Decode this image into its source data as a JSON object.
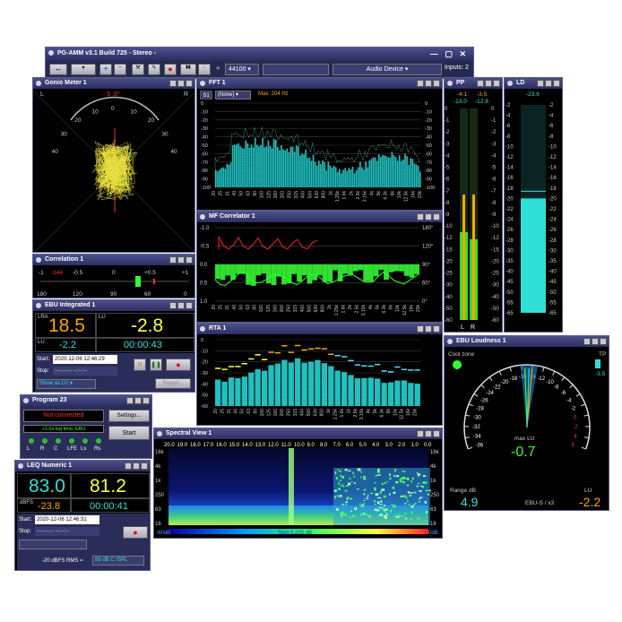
{
  "app": {
    "title": "PG-AMM v3.1 Build 725 - Stereo -",
    "samplerate": "44100",
    "audio_device": "Audio Device",
    "inputs": "Inputs: 2"
  },
  "gonio": {
    "title": "Gonio Meter 1",
    "left": "L",
    "right": "R",
    "angle": "- 5 .9°",
    "scale": [
      "40",
      "30",
      "20",
      "10",
      "0",
      "10",
      "20",
      "30",
      "40"
    ]
  },
  "fft": {
    "title": "FFT 1",
    "slot": "S1",
    "mode": "(None)",
    "max": "Max: 204 Hz",
    "yticks": [
      "0",
      "-10",
      "-20",
      "-30",
      "-40",
      "-50",
      "-60",
      "-70",
      "-80",
      "-90",
      "-100"
    ],
    "yticks_right": [
      "0",
      "-10",
      "-20",
      "-30",
      "-40",
      "-50",
      "-60",
      "-70",
      "-80",
      "-90",
      "-100"
    ],
    "xticks": [
      "20",
      "25",
      "31",
      "40",
      "50",
      "63",
      "80",
      "100",
      "125",
      "160",
      "200",
      "250",
      "315",
      "400",
      "500",
      "630",
      "800",
      "1k",
      "1.25k",
      "1.6k",
      "2k",
      "2.5k",
      "3.15k",
      "4k",
      "5k",
      "6.3k",
      "8k",
      "10k",
      "12.5k",
      "16k",
      "20k"
    ]
  },
  "mf": {
    "title": "MF Correlator 1",
    "yticks": [
      "-1.0",
      "-0.5",
      "0.0",
      "0.5",
      "1.0"
    ],
    "yticks_right": [
      "180°",
      "120°",
      "90°",
      "60°",
      "0°"
    ]
  },
  "rta": {
    "title": "RTA 1",
    "yticks": [
      "0",
      "-10",
      "-20",
      "-30",
      "-40",
      "-50",
      "-60"
    ]
  },
  "correlation": {
    "title": "Correlation 1",
    "top": [
      "-1",
      "-0.5",
      "0",
      "+0.5",
      "+1"
    ],
    "bottom": [
      "180",
      "120",
      "90",
      "60",
      "0"
    ],
    "value": "-144"
  },
  "ebu_int": {
    "title": "EBU Integrated 1",
    "lra_label": "LRA",
    "lu_label": "LU",
    "lra": "18.5",
    "lu": "-2.8",
    "lu_small_label": "LU",
    "lu_small": "-2.2",
    "time": "00:00:43",
    "start_label": "Start:",
    "start": "2020-12-06 12:46:29",
    "stop_label": "Stop:",
    "stop": "----.--.-- --:--:--",
    "show": "Show as LU",
    "report": "Report...",
    "r_btn": "R"
  },
  "program": {
    "title": "Program 23",
    "status": "Not connected",
    "settings": "Settings...",
    "loudness": "+1.0x loq time, EBU",
    "start": "Start",
    "channels": [
      "L",
      "R",
      "C",
      "LFE",
      "Ls",
      "Rs"
    ]
  },
  "leq": {
    "title": "LEQ Numeric 1",
    "v1": "83.0",
    "v2": "81.2",
    "dbfs_label": "dBFS",
    "dbfs": "-23.8",
    "time": "00:00:41",
    "start_label": "Start:",
    "start": "2020-12-06 12:46:31",
    "stop_label": "Stop:",
    "stop": "----.--.-- --:--:--",
    "rms_label": "-20 dBFS RMS =",
    "rms_value": "85 dB C /SPL"
  },
  "spectral": {
    "title": "Spectral View 1",
    "top": [
      "20.0",
      "19.0",
      "18.0",
      "17.0",
      "16.0",
      "15.0",
      "14.0",
      "13.0",
      "12.0",
      "11.0",
      "10.0",
      "9.0",
      "8.0",
      "7.0",
      "6.0",
      "5.0",
      "4.0",
      "3.0",
      "2.0",
      "1.0",
      "0.0"
    ],
    "left": [
      "16k",
      "4k",
      "1k",
      "250",
      "63",
      "16"
    ],
    "right": [
      "16k",
      "4k",
      "1k",
      "250",
      "63",
      "16"
    ],
    "bottom_left": "-60dB",
    "step": "Step 0.235 dB",
    "bottom_right": "0dB"
  },
  "ppm": {
    "title": "PP",
    "top": [
      "-4.1",
      "-3.5"
    ],
    "top2": [
      "-13.0",
      "-12.8"
    ],
    "scale": [
      "0",
      "-1",
      "-2",
      "-3",
      "-4",
      "-5",
      "-6",
      "-7",
      "-8",
      "-9",
      "-10",
      "-12",
      "-15",
      "-20",
      "-25",
      "-30",
      "-40",
      "-50",
      "-60"
    ],
    "labels": [
      "L",
      "R"
    ]
  },
  "ld": {
    "title": "LD",
    "value": "-23.6",
    "scale": [
      "-2",
      "-4",
      "-6",
      "-8",
      "-10",
      "-12",
      "-14",
      "-16",
      "-18",
      "-20",
      "-22",
      "-24",
      "-26",
      "-28",
      "-30",
      "-35",
      "-40",
      "-45",
      "-50",
      "-55",
      "-65"
    ],
    "label": "L-S",
    "level": 0.55
  },
  "ebu_loud": {
    "title": "EBU Loudness 1",
    "cool": "Cool zone",
    "tp": "TP",
    "tp_value": "-3.5",
    "max_label": "max LU",
    "max_value": "-0.7",
    "range_label": "Range dB",
    "range_value": "4.9",
    "lu_label": "LU",
    "lu_value": "-2.2",
    "scale_name": "EBU-S / x3",
    "ticks": [
      "-36",
      "-34",
      "-32",
      "-30",
      "-28",
      "-26",
      "-24",
      "-22",
      "-20",
      "-18",
      "-16",
      "-14",
      "-12",
      "-10",
      "-8",
      "-6",
      "-4",
      "-2",
      "0",
      "2",
      "4",
      "6"
    ]
  },
  "colors": {
    "bg": "#000000",
    "frame": "#5a5f8a",
    "title": "#2c2f63",
    "orange": "#ffa500",
    "yellow": "#ffff40",
    "cyan": "#2ee0d8",
    "green": "#30ff30",
    "red": "#ff3030"
  }
}
